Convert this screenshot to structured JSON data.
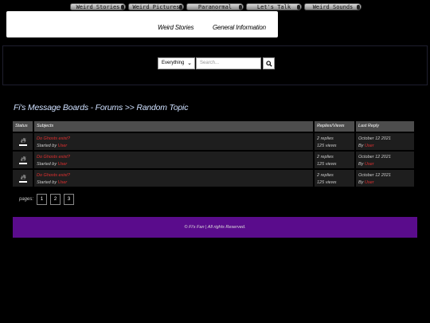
{
  "nav": {
    "tabs": [
      "Weird Stories",
      "Weird Pictures",
      "Paranormal Links",
      "Let's Talk",
      "Weird Sounds"
    ]
  },
  "header": {
    "links": [
      "Weird Stories",
      "General Information"
    ]
  },
  "search": {
    "scope": "Everything",
    "placeholder": "Search...",
    "button_icon": "search-icon"
  },
  "breadcrumb": "Fi's Message Boards - Forums >> Random Topic",
  "table": {
    "headers": [
      "Status",
      "Subjects",
      "Replies/Views",
      "Last Reply"
    ],
    "rows": [
      {
        "status_icon": "flame-icon",
        "subject": "Do Ghosts exist?",
        "started_by_label": "Started by",
        "started_by": "User",
        "replies": "2 replies",
        "views": "125 views",
        "date": "October 12 2021",
        "by_label": "By",
        "last_user": "User"
      },
      {
        "status_icon": "flame-icon",
        "subject": "Do Ghosts exist?",
        "started_by_label": "Started by",
        "started_by": "User",
        "replies": "2 replies",
        "views": "125 views",
        "date": "October 12 2021",
        "by_label": "By",
        "last_user": "User"
      },
      {
        "status_icon": "flame-icon",
        "subject": "Do Ghosts exist?",
        "started_by_label": "Started by",
        "started_by": "User",
        "replies": "2 replies",
        "views": "125 views",
        "date": "October 12 2021",
        "by_label": "By",
        "last_user": "User"
      }
    ]
  },
  "pagination": {
    "label": "pages:",
    "pages": [
      "1",
      "2",
      "3"
    ]
  },
  "footer": {
    "text": "© Fi's Fan | All rights Reserved."
  },
  "colors": {
    "background": "#000000",
    "footer": "#5a0c8c",
    "link_red": "#e23030",
    "header_row": "#4d4d4d"
  }
}
